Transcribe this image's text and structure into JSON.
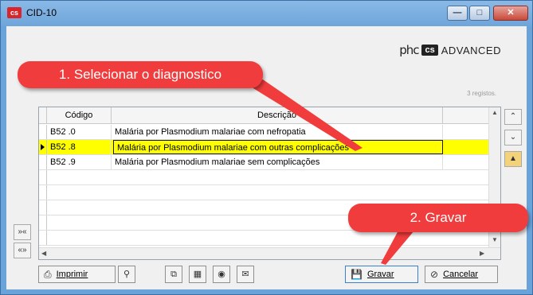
{
  "window": {
    "title": "CID-10",
    "app_icon_text": "cs",
    "controls": [
      "minimize-icon",
      "maximize-icon",
      "close-icon"
    ]
  },
  "brand": {
    "phc": "phc",
    "cs": "cs",
    "advanced": "ADVANCED"
  },
  "record_count": "3 registos.",
  "grid": {
    "headers": [
      "Código",
      "Descrição"
    ],
    "rows": [
      {
        "codigo": "B52 .0",
        "descricao": "Malária por Plasmodium malariae com nefropatia"
      },
      {
        "codigo": "B52 .8",
        "descricao": "Malária por Plasmodium malariae com outras complicações"
      },
      {
        "codigo": "B52 .9",
        "descricao": "Malária por Plasmodium malariae sem complicações"
      }
    ],
    "selected_row": 1
  },
  "buttons": {
    "print": "Imprimir",
    "save": "Gravar",
    "cancel": "Cancelar"
  },
  "side_nav": [
    "»«",
    "«»"
  ],
  "right_tools": [
    "scroll-up-icon",
    "scroll-down-icon",
    "folder-up-icon"
  ],
  "callouts": {
    "step1": "1. Selecionar o diagnostico",
    "step2": "2. Gravar"
  },
  "colors": {
    "selection": "#ffff00",
    "callout": "#f03c3c",
    "titlebar": "#6ea5da"
  }
}
